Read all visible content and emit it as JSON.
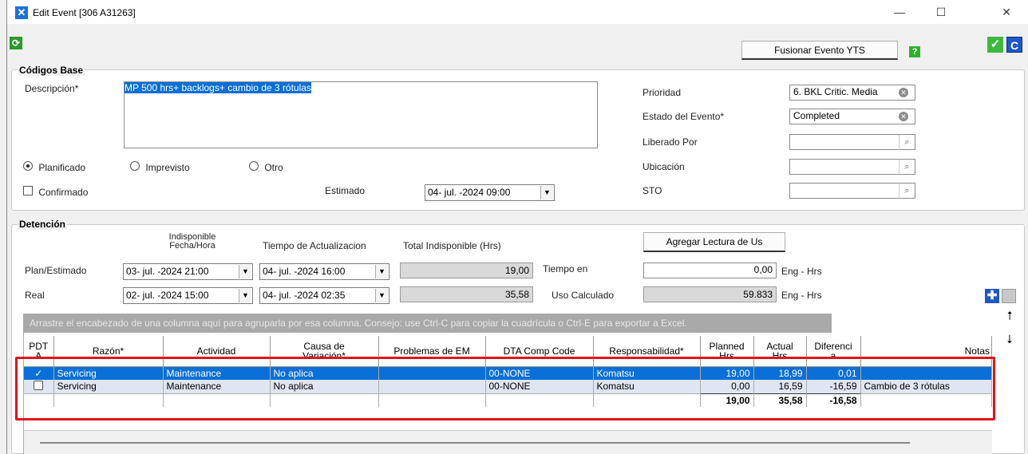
{
  "window": {
    "title": "Edit Event [306 A31263]",
    "minimize": "—",
    "maximize": "☐",
    "close": "✕"
  },
  "toolbar": {
    "refresh_icon": "refresh-icon",
    "merge_button": "Fusionar Evento YTS",
    "help": "?",
    "ok": "✓",
    "c_button": "C"
  },
  "codigos_base": {
    "title": "Códigos Base",
    "descripcion_label": "Descripción*",
    "descripcion_value": "MP 500 hrs+ backlogs+ cambio de 3 rótulas",
    "radios": [
      {
        "label": "Planificado",
        "selected": true
      },
      {
        "label": "Imprevisto",
        "selected": false
      },
      {
        "label": "Otro",
        "selected": false
      }
    ],
    "confirmado_label": "Confirmado",
    "estimado_label": "Estimado",
    "estimado_value": "04- jul. -2024 09:00",
    "prioridad_label": "Prioridad",
    "prioridad_value": "6. BKL Critic. Media",
    "estado_label": "Estado del Evento*",
    "estado_value": "Completed",
    "liberado_label": "Liberado Por",
    "liberado_value": "",
    "ubicacion_label": "Ubicación",
    "ubicacion_value": "",
    "sto_label": "STO",
    "sto_value": ""
  },
  "detencion": {
    "title": "Detención",
    "col1_header": "Indisponible Fecha/Hora",
    "col2_header": "Tiempo de Actualizacion",
    "col3_header": "Total Indisponible (Hrs)",
    "agregar_button": "Agregar Lectura de Us",
    "plan_label": "Plan/Estimado",
    "plan_indisp": "03- jul. -2024 21:00",
    "plan_actual": "04- jul. -2024 16:00",
    "plan_total": "19,00",
    "tiempo_label": "Tiempo en",
    "tiempo_value": "0,00",
    "tiempo_unit": "Eng - Hrs",
    "real_label": "Real",
    "real_indisp": "02- jul. -2024 15:00",
    "real_actual": "04- jul. -2024 02:35",
    "real_total": "35,58",
    "uso_label": "Uso Calculado",
    "uso_value": "59.833",
    "uso_unit": "Eng - Hrs"
  },
  "grid": {
    "group_hint": "Arrastre el encabezado de una columna aquí para agruparla por esa columna. Consejo: use Ctrl-C para copiar la cuadrícula o Ctrl-E para exportar a Excel.",
    "columns": [
      "PDT\nA",
      "Razón*",
      "Actividad",
      "Causa de\nVariación*",
      "Problemas de EM",
      "DTA Comp Code",
      "Responsabilidad*",
      "Planned\nHrs",
      "Actual\nHrs",
      "Diferenci\na",
      "Notas"
    ],
    "rows": [
      {
        "pdta": true,
        "razon": "Servicing",
        "actividad": "Maintenance",
        "causa": "No aplica",
        "problemas": "",
        "dta": "00-NONE",
        "resp": "Komatsu",
        "planned": "19,00",
        "actual": "18,99",
        "dif": "0,01",
        "notas": ""
      },
      {
        "pdta": false,
        "razon": "Servicing",
        "actividad": "Maintenance",
        "causa": "No aplica",
        "problemas": "",
        "dta": "00-NONE",
        "resp": "Komatsu",
        "planned": "0,00",
        "actual": "16,59",
        "dif": "-16,59",
        "notas": "Cambio de 3 rótulas"
      }
    ],
    "totals": {
      "planned": "19,00",
      "actual": "35,58",
      "dif": "-16,58"
    }
  }
}
